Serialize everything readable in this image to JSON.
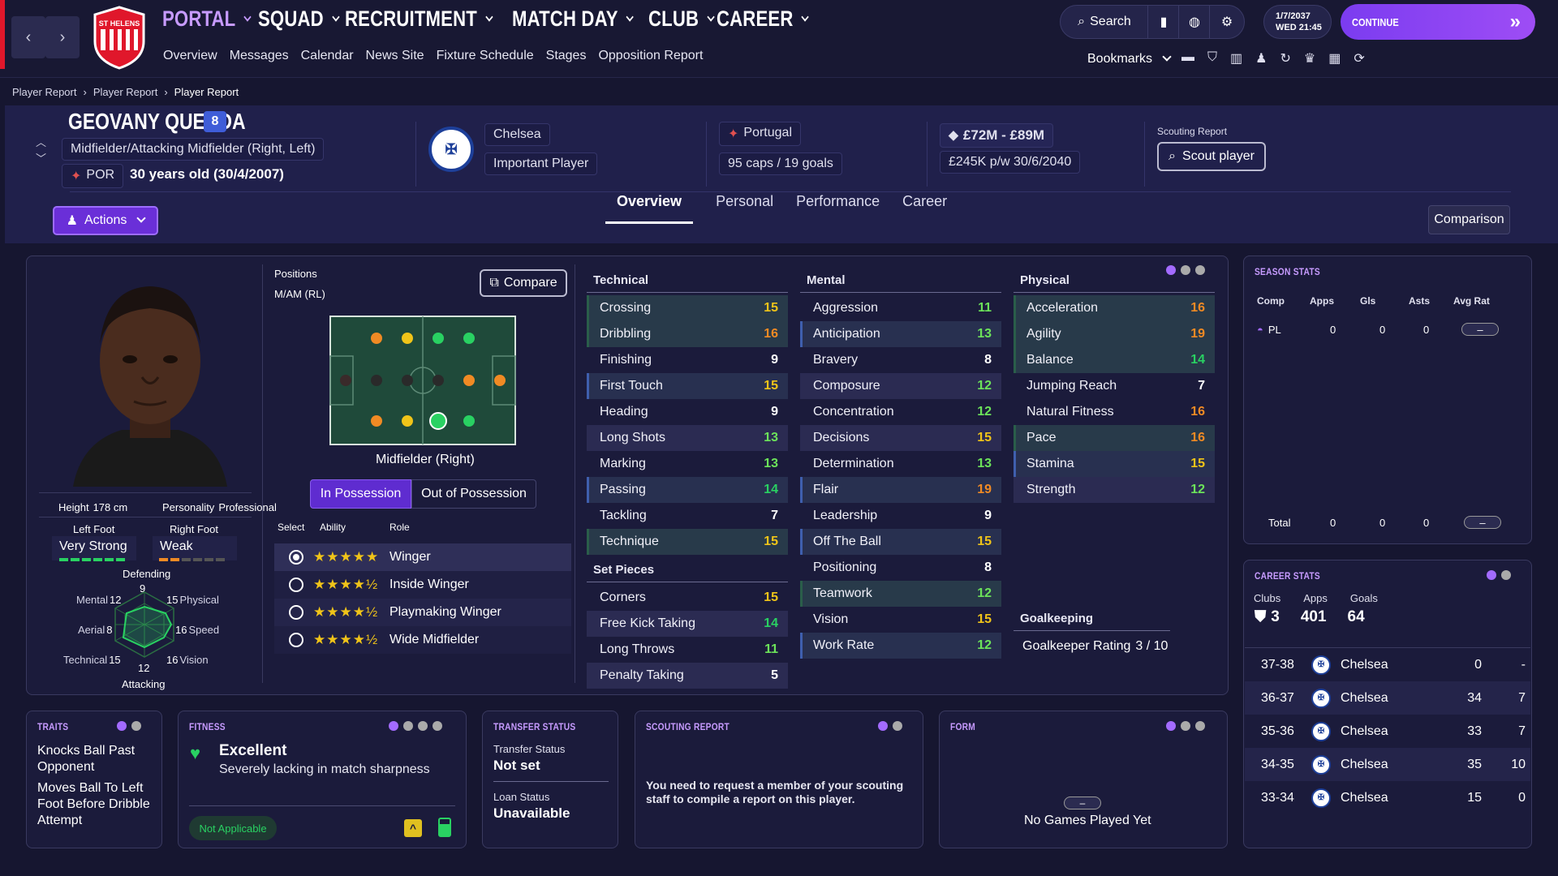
{
  "nav": {
    "main": [
      "PORTAL",
      "SQUAD",
      "RECRUITMENT",
      "MATCH DAY",
      "CLUB",
      "CAREER"
    ],
    "sub": [
      "Overview",
      "Messages",
      "Calendar",
      "News Site",
      "Fixture Schedule",
      "Stages",
      "Opposition Report"
    ],
    "club_badge": "ST HELENS"
  },
  "toolbar": {
    "search": "Search",
    "date": "1/7/2037",
    "day_time": "WED  21:45",
    "continue": "CONTINUE",
    "bookmarks": "Bookmarks"
  },
  "breadcrumb": [
    "Player Report",
    "Player Report",
    "Player Report"
  ],
  "player": {
    "name": "GEOVANY QUENDA",
    "number": "8",
    "position": "Midfielder/Attacking Midfielder (Right, Left)",
    "nation_code": "POR",
    "age": "30 years old (30/4/2007)",
    "club": "Chelsea",
    "squad_status": "Important Player",
    "nation": "Portugal",
    "caps": "95 caps / 19 goals",
    "value": "£72M - £89M",
    "wage": "£245K p/w 30/6/2040",
    "scouting_label": "Scouting Report",
    "scout_button": "Scout player"
  },
  "actions": "Actions",
  "tabs": [
    "Overview",
    "Personal",
    "Performance",
    "Career"
  ],
  "comparison": "Comparison",
  "profile": {
    "height_label": "Height",
    "height": "178 cm",
    "personality_label": "Personality",
    "personality": "Professional",
    "left_foot_label": "Left Foot",
    "left_foot": "Very Strong",
    "right_foot_label": "Right Foot",
    "right_foot": "Weak",
    "radar": {
      "top": "Defending",
      "bottom": "Attacking",
      "mental_label": "Mental",
      "mental": "12",
      "physical_label": "Physical",
      "physical": "15",
      "aerial_label": "Aerial",
      "aerial": "8",
      "speed_label": "Speed",
      "speed": "16",
      "technical_label": "Technical",
      "technical": "15",
      "vision_label": "Vision",
      "vision": "16",
      "defending": "9",
      "attacking": "12"
    }
  },
  "positions": {
    "label": "Positions",
    "value": "M/AM (RL)",
    "compare": "Compare",
    "pitch_caption": "Midfielder (Right)",
    "possession_on": "In Possession",
    "possession_off": "Out of Possession",
    "col_select": "Select",
    "col_ability": "Ability",
    "col_role": "Role",
    "roles": [
      {
        "name": "Winger",
        "stars": "★★★★★"
      },
      {
        "name": "Inside Winger",
        "stars": "★★★★½"
      },
      {
        "name": "Playmaking Winger",
        "stars": "★★★★½"
      },
      {
        "name": "Wide Midfielder",
        "stars": "★★★★½"
      }
    ]
  },
  "technical": {
    "title": "Technical",
    "rows": [
      {
        "name": "Crossing",
        "value": "15"
      },
      {
        "name": "Dribbling",
        "value": "16"
      },
      {
        "name": "Finishing",
        "value": "9"
      },
      {
        "name": "First Touch",
        "value": "15"
      },
      {
        "name": "Heading",
        "value": "9"
      },
      {
        "name": "Long Shots",
        "value": "13"
      },
      {
        "name": "Marking",
        "value": "13"
      },
      {
        "name": "Passing",
        "value": "14"
      },
      {
        "name": "Tackling",
        "value": "7"
      },
      {
        "name": "Technique",
        "value": "15"
      }
    ]
  },
  "set_pieces": {
    "title": "Set Pieces",
    "rows": [
      {
        "name": "Corners",
        "value": "15"
      },
      {
        "name": "Free Kick Taking",
        "value": "14"
      },
      {
        "name": "Long Throws",
        "value": "11"
      },
      {
        "name": "Penalty Taking",
        "value": "5"
      }
    ]
  },
  "mental": {
    "title": "Mental",
    "rows": [
      {
        "name": "Aggression",
        "value": "11"
      },
      {
        "name": "Anticipation",
        "value": "13"
      },
      {
        "name": "Bravery",
        "value": "8"
      },
      {
        "name": "Composure",
        "value": "12"
      },
      {
        "name": "Concentration",
        "value": "12"
      },
      {
        "name": "Decisions",
        "value": "15"
      },
      {
        "name": "Determination",
        "value": "13"
      },
      {
        "name": "Flair",
        "value": "19"
      },
      {
        "name": "Leadership",
        "value": "9"
      },
      {
        "name": "Off The Ball",
        "value": "15"
      },
      {
        "name": "Positioning",
        "value": "8"
      },
      {
        "name": "Teamwork",
        "value": "12"
      },
      {
        "name": "Vision",
        "value": "15"
      },
      {
        "name": "Work Rate",
        "value": "12"
      }
    ]
  },
  "physical": {
    "title": "Physical",
    "rows": [
      {
        "name": "Acceleration",
        "value": "16"
      },
      {
        "name": "Agility",
        "value": "19"
      },
      {
        "name": "Balance",
        "value": "14"
      },
      {
        "name": "Jumping Reach",
        "value": "7"
      },
      {
        "name": "Natural Fitness",
        "value": "16"
      },
      {
        "name": "Pace",
        "value": "16"
      },
      {
        "name": "Stamina",
        "value": "15"
      },
      {
        "name": "Strength",
        "value": "12"
      }
    ]
  },
  "goalkeeping": {
    "title": "Goalkeeping",
    "rating_label": "Goalkeeper Rating",
    "rating": "3 / 10"
  },
  "season_stats": {
    "title": "SEASON STATS",
    "cols": [
      "Comp",
      "Apps",
      "Gls",
      "Asts",
      "Avg Rat"
    ],
    "row": {
      "comp": "PL",
      "apps": "0",
      "gls": "0",
      "asts": "0",
      "avg": "–"
    },
    "total": {
      "label": "Total",
      "apps": "0",
      "gls": "0",
      "asts": "0",
      "avg": "–"
    }
  },
  "career_stats": {
    "title": "CAREER STATS",
    "labels": [
      "Clubs",
      "Apps",
      "Goals"
    ],
    "values": [
      "3",
      "401",
      "64"
    ],
    "rows": [
      {
        "season": "37-38",
        "club": "Chelsea",
        "apps": "0",
        "goals": "-"
      },
      {
        "season": "36-37",
        "club": "Chelsea",
        "apps": "34",
        "goals": "7"
      },
      {
        "season": "35-36",
        "club": "Chelsea",
        "apps": "33",
        "goals": "7"
      },
      {
        "season": "34-35",
        "club": "Chelsea",
        "apps": "35",
        "goals": "10"
      },
      {
        "season": "33-34",
        "club": "Chelsea",
        "apps": "15",
        "goals": "0"
      }
    ]
  },
  "traits": {
    "title": "TRAITS",
    "items": [
      "Knocks Ball Past Opponent",
      "Moves Ball To Left Foot Before Dribble Attempt"
    ]
  },
  "fitness": {
    "title": "FITNESS",
    "status": "Excellent",
    "detail": "Severely lacking in match sharpness",
    "badge": "Not Applicable"
  },
  "transfer": {
    "title": "TRANSFER STATUS",
    "status_label": "Transfer Status",
    "status": "Not set",
    "loan_label": "Loan Status",
    "loan": "Unavailable"
  },
  "scouting": {
    "title": "SCOUTING REPORT",
    "text": "You need to request a member of your scouting staff to compile a report on this player."
  },
  "form": {
    "title": "FORM",
    "dash": "–",
    "text": "No Games Played Yet"
  },
  "colors": {
    "accent": "#a36bff",
    "green": "#29d162",
    "yellow": "#f0c419",
    "orange": "#f08a24",
    "bg": "#161630"
  }
}
